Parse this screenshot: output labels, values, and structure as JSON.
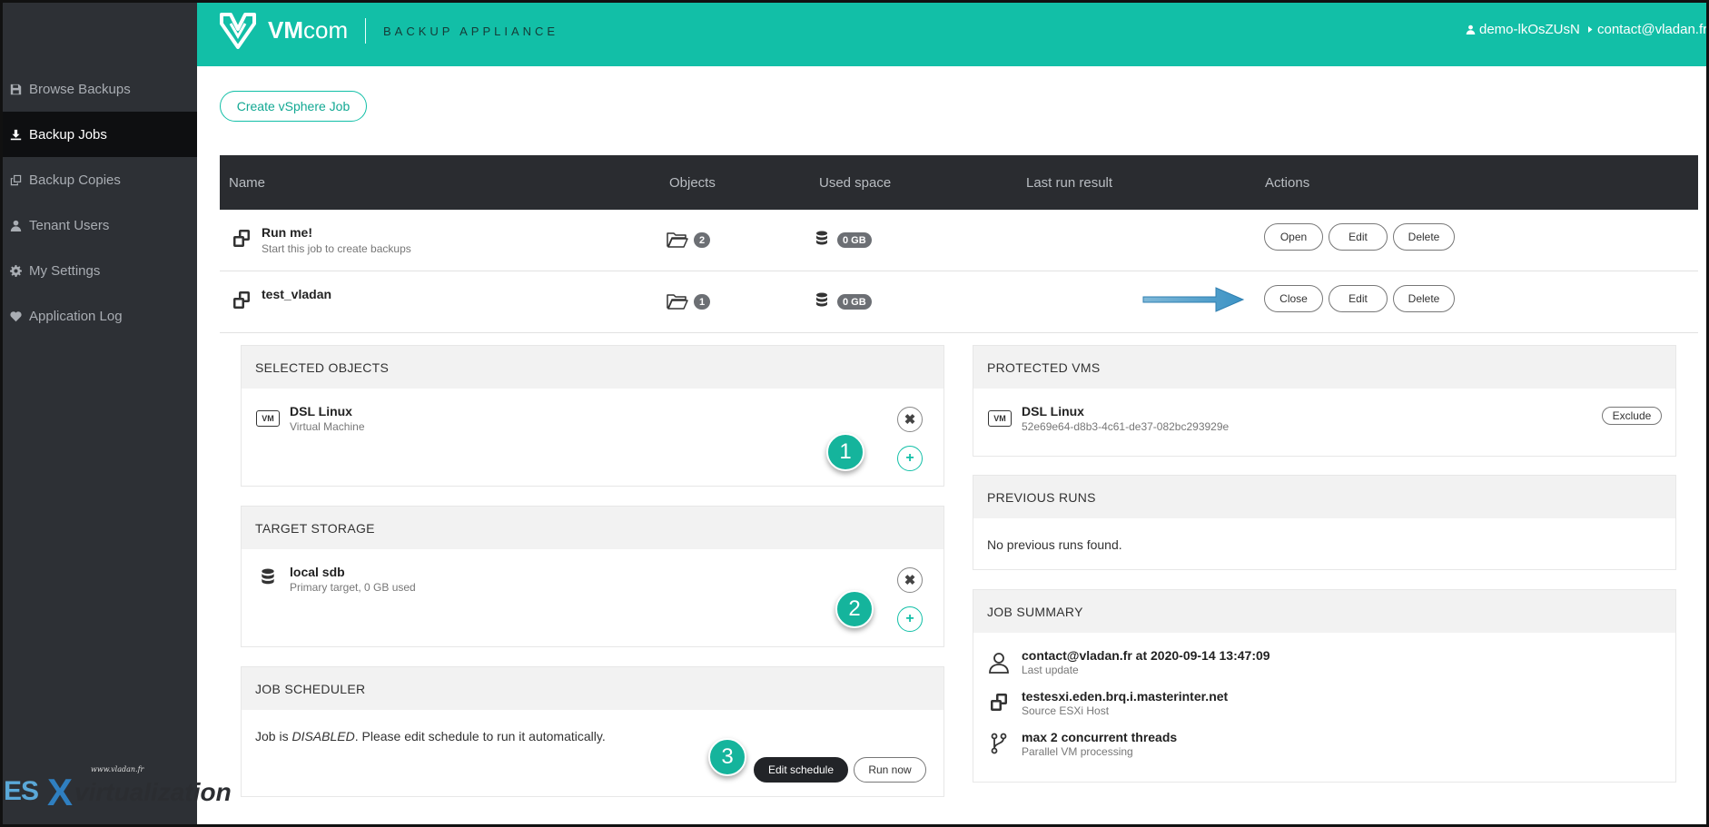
{
  "app": {
    "brand_main": "VM",
    "brand_rest": "com",
    "subtitle": "BACKUP APPLIANCE",
    "user": "demo-lkOsZUsN",
    "contact": "contact@vladan.fr",
    "accent_color": "#12bfa7"
  },
  "sidebar": {
    "items": [
      {
        "label": "Browse Backups",
        "icon": "save-icon"
      },
      {
        "label": "Backup Jobs",
        "icon": "download-icon",
        "active": true
      },
      {
        "label": "Backup Copies",
        "icon": "copy-icon"
      },
      {
        "label": "Tenant Users",
        "icon": "user-icon"
      },
      {
        "label": "My Settings",
        "icon": "gear-icon"
      },
      {
        "label": "Application Log",
        "icon": "heartbeat-icon"
      }
    ]
  },
  "watermark": {
    "url": "www.vladan.fr",
    "es": "ES",
    "x": "X",
    "rest": "virtualization"
  },
  "toolbar": {
    "create_label": "Create vSphere Job"
  },
  "table": {
    "headers": {
      "name": "Name",
      "objects": "Objects",
      "used": "Used space",
      "last": "Last run result",
      "actions": "Actions"
    },
    "rows": [
      {
        "name": "Run me!",
        "sub": "Start this job to create backups",
        "objects": "2",
        "used": "0 GB",
        "a1": "Open",
        "a2": "Edit",
        "a3": "Delete"
      },
      {
        "name": "test_vladan",
        "sub": "",
        "objects": "1",
        "used": "0 GB",
        "a1": "Close",
        "a2": "Edit",
        "a3": "Delete"
      }
    ]
  },
  "selected_objects": {
    "title": "SELECTED OBJECTS",
    "item_name": "DSL Linux",
    "item_type": "Virtual Machine",
    "vm_tag": "VM",
    "step": "1"
  },
  "target_storage": {
    "title": "TARGET STORAGE",
    "item_name": "local sdb",
    "item_sub": "Primary target, 0 GB used",
    "step": "2"
  },
  "job_scheduler": {
    "title": "JOB SCHEDULER",
    "text_pre": "Job is ",
    "text_state": "DISABLED",
    "text_post": ". Please edit schedule to run it automatically.",
    "edit_label": "Edit schedule",
    "run_label": "Run now",
    "step": "3"
  },
  "protected_vms": {
    "title": "PROTECTED VMS",
    "item_name": "DSL Linux",
    "item_id": "52e69e64-d8b3-4c61-de37-082bc293929e",
    "vm_tag": "VM",
    "exclude_label": "Exclude"
  },
  "previous_runs": {
    "title": "PREVIOUS RUNS",
    "empty": "No previous runs found."
  },
  "job_summary": {
    "title": "JOB SUMMARY",
    "items": [
      {
        "value": "contact@vladan.fr at 2020-09-14 13:47:09",
        "label": "Last update",
        "icon": "user-icon"
      },
      {
        "value": "testesxi.eden.brq.i.masterinter.net",
        "label": "Source ESXi Host",
        "icon": "vsphere-icon"
      },
      {
        "value": "max 2 concurrent threads",
        "label": "Parallel VM processing",
        "icon": "fork-icon"
      }
    ]
  }
}
